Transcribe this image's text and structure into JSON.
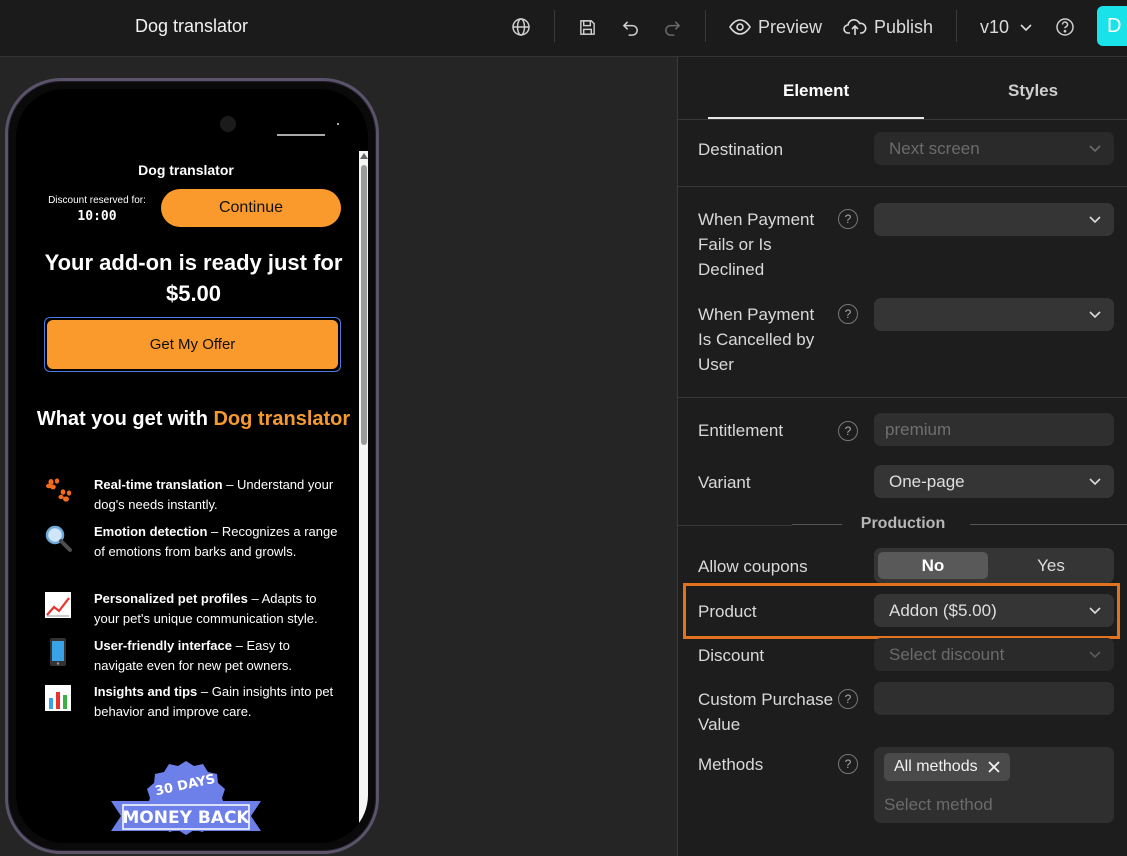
{
  "topbar": {
    "title": "Dog translator",
    "preview_label": "Preview",
    "publish_label": "Publish",
    "version": "v10",
    "avatar_initial": "D",
    "icons": [
      "globe-icon",
      "save-icon",
      "undo-icon",
      "redo-icon",
      "eye-icon",
      "cloud-upload-icon",
      "chevron-down-icon",
      "help-icon"
    ]
  },
  "phone": {
    "title": "Dog translator",
    "discount_label": "Discount reserved for:",
    "timer": "10:00",
    "continue_label": "Continue",
    "headline": "Your add-on is ready just for $5.00",
    "offer_label": "Get My Offer",
    "what_prefix": "What you get with ",
    "what_accent": "Dog translator",
    "features": [
      {
        "icon": "paw-icon",
        "title": "Real-time translation",
        "text": " – Understand your dog's needs instantly."
      },
      {
        "icon": "magnifier-icon",
        "title": "Emotion detection",
        "text": " – Recognizes a range of emotions from barks and growls."
      },
      {
        "icon": "chart-up-icon",
        "title": "Personalized pet profiles",
        "text": " – Adapts to your pet's unique communication style."
      },
      {
        "icon": "phone-icon",
        "title": "User-friendly interface",
        "text": " – Easy to navigate even for new pet owners."
      },
      {
        "icon": "bar-chart-icon",
        "title": "Insights and tips",
        "text": " – Gain insights into pet behavior and improve care."
      }
    ],
    "badge_top": "30 DAYS",
    "badge_main": "MONEY BACK"
  },
  "panel": {
    "tabs": {
      "element": "Element",
      "styles": "Styles"
    },
    "destination_label": "Destination",
    "destination_value": "Next screen",
    "payment_fails_label": "When Payment Fails or Is Declined",
    "payment_fails_value": "",
    "payment_cancelled_label": "When Payment Is Cancelled by User",
    "payment_cancelled_value": "",
    "entitlement_label": "Entitlement",
    "entitlement_placeholder": "premium",
    "variant_label": "Variant",
    "variant_value": "One-page",
    "section_production": "Production",
    "coupons_label": "Allow coupons",
    "coupons_no": "No",
    "coupons_yes": "Yes",
    "product_label": "Product",
    "product_value": "Addon ($5.00)",
    "discount_label": "Discount",
    "discount_placeholder": "Select discount",
    "custom_value_label": "Custom Purchase Value",
    "methods_label": "Methods",
    "methods_chip": "All methods",
    "methods_placeholder": "Select method",
    "help_glyph": "?"
  },
  "colors": {
    "accent_orange": "#fb9a2c",
    "highlight_border": "#e2721d",
    "avatar": "#19e3e8",
    "badge_blue": "#6d7fe8"
  }
}
